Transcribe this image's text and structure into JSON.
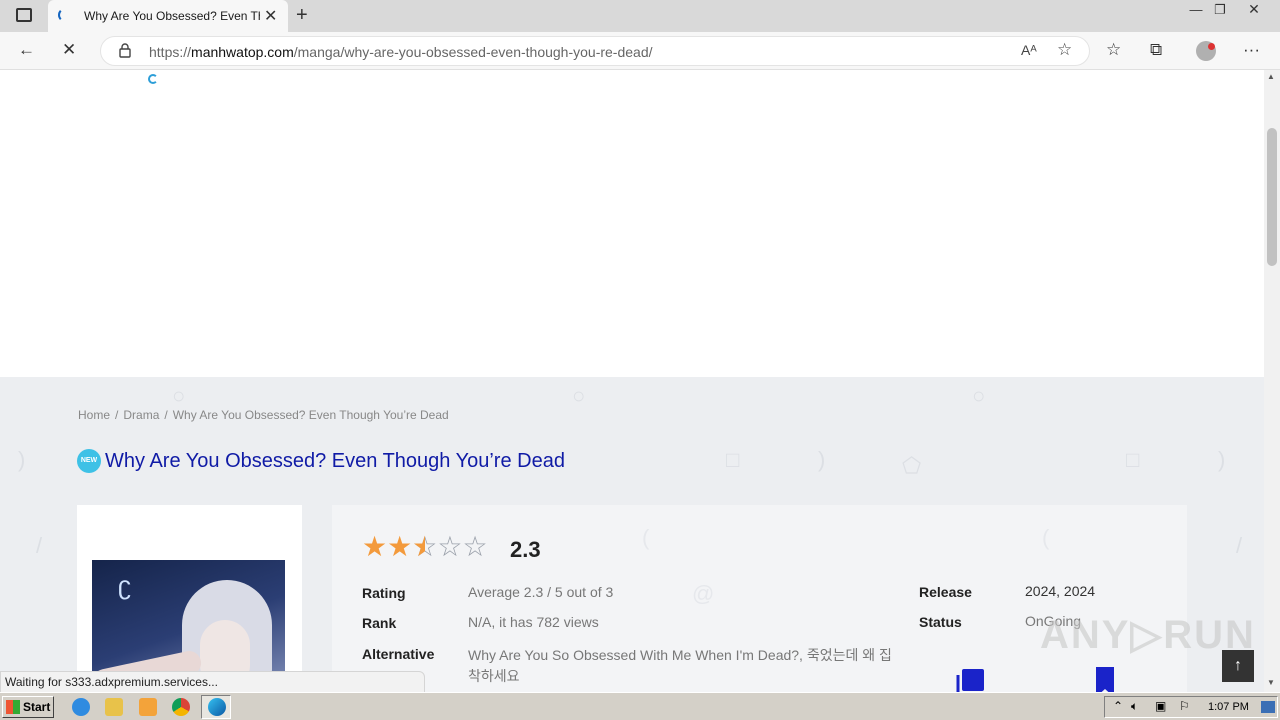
{
  "browser": {
    "tab_title": "Why Are You Obsessed? Even Tho",
    "tab_close": "✕",
    "new_tab": "+",
    "url_prefix": "https://",
    "url_host": "manhwatop.com",
    "url_path": "/manga/why-are-you-obsessed-even-though-you-re-dead/",
    "window_controls": [
      "—",
      "❐",
      "✕"
    ]
  },
  "page": {
    "breadcrumb": [
      "Home",
      "Drama",
      "Why Are You Obsessed? Even Though You’re Dead"
    ],
    "new_badge": "NEW",
    "title": "Why Are You Obsessed? Even Though You’re Dead",
    "rating_stars": 2.3,
    "rating_score": "2.3",
    "info": {
      "rating_label": "Rating",
      "rating_value": "Average 2.3 / 5 out of 3",
      "rank_label": "Rank",
      "rank_value": "N/A, it has 782 views",
      "alternative_label": "Alternative",
      "alternative_value_line1": "Why Are You So Obsessed With Me When I'm Dead?, 죽었는데 왜 집",
      "alternative_value_line2": "착하세요",
      "release_label": "Release",
      "release_value": "2024, 2024",
      "status_label": "Status",
      "status_value": "OnGoing"
    }
  },
  "status_bar": "Waiting for s333.adxpremium.services...",
  "back_to_top": "↑",
  "watermark": "ANY▷RUN",
  "taskbar": {
    "start_label": "Start",
    "clock": "1:07 PM"
  },
  "colors": {
    "title": "#101ba6",
    "star": "#f39a3c",
    "badge": "#3ec1e6"
  }
}
